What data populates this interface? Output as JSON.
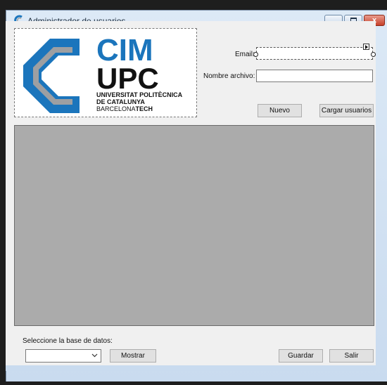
{
  "window": {
    "title": "Administrador de usuarios",
    "controls": {
      "minimize": "minimize",
      "maximize": "maximize",
      "close": "x"
    }
  },
  "logo": {
    "line1": "CIM",
    "line2": "UPC",
    "line3": "UNIVERSITAT POLITÈCNICA",
    "line4": "DE CATALUNYA",
    "line5_a": "BARCELONA",
    "line5_b": "TECH",
    "colors": {
      "blue": "#1b75bc",
      "gray": "#9d9fa2",
      "black": "#111111"
    }
  },
  "form": {
    "email_label": "Email:",
    "email_value": "",
    "file_label": "Nombre archivo:",
    "file_value": ""
  },
  "buttons": {
    "nuevo": "Nuevo",
    "cargar": "Cargar usuarios",
    "mostrar": "Mostrar",
    "guardar": "Guardar",
    "salir": "Salir"
  },
  "database": {
    "label": "Seleccione la base de datos:",
    "selected": ""
  },
  "colors": {
    "client_bg": "#f0f0f0",
    "grid_bg": "#ababab",
    "titlebar": "#dce9f6"
  }
}
